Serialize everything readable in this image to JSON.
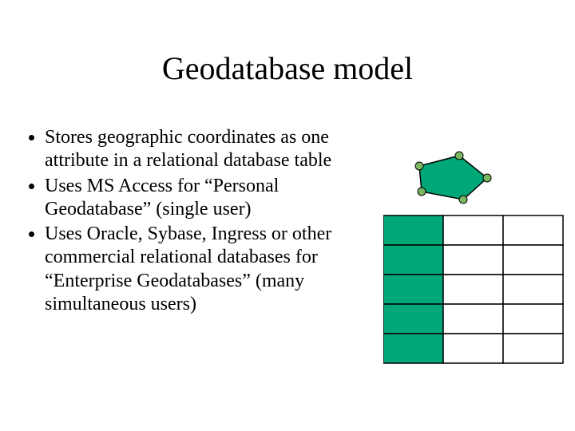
{
  "title": "Geodatabase model",
  "bullets": [
    "Stores geographic coordinates as one attribute in a relational database table",
    "Uses MS Access for “Personal Geodatabase” (single user)",
    "Uses Oracle, Sybase, Ingress or other commercial relational databases for “Enterprise Geodatabases” (many simultaneous users)"
  ],
  "diagram": {
    "polygon_fill": "#00A878",
    "polygon_stroke": "#000000",
    "node_fill": "#7BB661",
    "node_stroke": "#000000",
    "table": {
      "rows": 5,
      "cols": 3,
      "highlight_col": 0,
      "cell_fill": "#ffffff",
      "highlight_fill": "#00A878",
      "stroke": "#000000"
    }
  }
}
